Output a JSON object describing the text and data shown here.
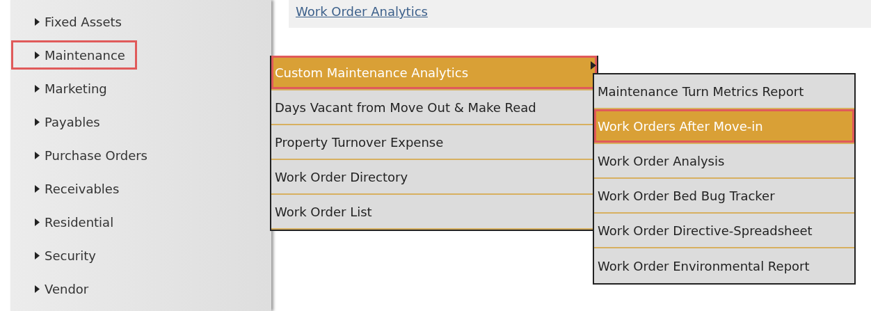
{
  "header_link": "Work Order Analytics",
  "sidebar": {
    "items": [
      {
        "label": "Fixed Assets",
        "highlighted": false
      },
      {
        "label": "Maintenance",
        "highlighted": true
      },
      {
        "label": "Marketing",
        "highlighted": false
      },
      {
        "label": "Payables",
        "highlighted": false
      },
      {
        "label": "Purchase Orders",
        "highlighted": false
      },
      {
        "label": "Receivables",
        "highlighted": false
      },
      {
        "label": "Residential",
        "highlighted": false
      },
      {
        "label": "Security",
        "highlighted": false
      },
      {
        "label": "Vendor",
        "highlighted": false
      }
    ]
  },
  "menu": {
    "items": [
      {
        "label": "Custom Maintenance Analytics",
        "selected": true,
        "highlighted": true,
        "has_submenu": true
      },
      {
        "label": "Days Vacant from Move Out & Make Read",
        "selected": false,
        "highlighted": false,
        "has_submenu": false
      },
      {
        "label": "Property Turnover Expense",
        "selected": false,
        "highlighted": false,
        "has_submenu": false
      },
      {
        "label": "Work Order Directory",
        "selected": false,
        "highlighted": false,
        "has_submenu": false
      },
      {
        "label": "Work Order List",
        "selected": false,
        "highlighted": false,
        "has_submenu": false
      }
    ]
  },
  "submenu": {
    "items": [
      {
        "label": "Maintenance Turn Metrics Report",
        "selected": false,
        "highlighted": false
      },
      {
        "label": "Work Orders After Move-in",
        "selected": true,
        "highlighted": true
      },
      {
        "label": "Work Order Analysis",
        "selected": false,
        "highlighted": false
      },
      {
        "label": "Work Order Bed Bug Tracker",
        "selected": false,
        "highlighted": false
      },
      {
        "label": "Work Order Directive-Spreadsheet",
        "selected": false,
        "highlighted": false
      },
      {
        "label": "Work Order Environmental Report",
        "selected": false,
        "highlighted": false
      }
    ]
  }
}
